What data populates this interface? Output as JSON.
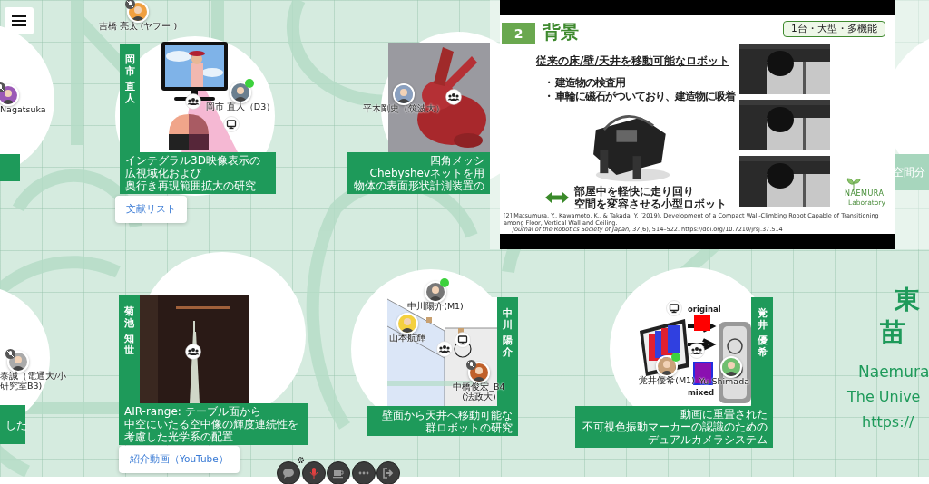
{
  "participants": [
    {
      "name": [
        "吉橋 亮太 (ヤフー )"
      ],
      "online": false,
      "muted": true
    },
    {
      "name": [
        "Nagatsuka"
      ],
      "online": false,
      "muted": true
    },
    {
      "name": [
        "岡市 直人（D3）"
      ],
      "online": true,
      "muted": false
    },
    {
      "name": [
        "平木剛史（筑波大）"
      ],
      "online": false,
      "muted": false
    },
    {
      "name": [
        "泰誠（電通大/小",
        "研究室B3)"
      ],
      "online": false,
      "muted": true
    },
    {
      "name": [
        "中川陽介(M1)"
      ],
      "online": true,
      "muted": false
    },
    {
      "name": [
        "山本航輝"
      ],
      "online": false,
      "muted": false
    },
    {
      "name": [
        "中橋俊宏_B4",
        "(法政大)"
      ],
      "online": false,
      "muted": true
    },
    {
      "name": [
        "覚井優希(M1)"
      ],
      "online": true,
      "muted": false
    },
    {
      "name": [
        "Yu Shimada"
      ],
      "online": false,
      "muted": false
    }
  ],
  "booths": [
    {
      "presenter": [
        "岡市",
        "直人"
      ],
      "title_lines": [
        "インテグラル3D映像表示の",
        "広視域化および",
        "奥行き再現範囲拡大の研究"
      ],
      "link": "文献リスト"
    },
    {
      "title_lines": [
        "四角メッシ",
        "Chebyshevネットを用",
        "物体の表面形状計測装置の"
      ]
    },
    {
      "title_lines": [
        "空間分"
      ]
    },
    {
      "title_lines": [
        "した"
      ]
    },
    {
      "presenter": [
        "菊池",
        "知世"
      ],
      "title_lines": [
        "AIR-range: テーブル面から",
        "中空にいたる空中像の輝度連続性を",
        "考慮した光学系の配置"
      ],
      "link": "紹介動画（YouTube）"
    },
    {
      "presenter": [
        "中川",
        "陽介"
      ],
      "title_lines": [
        "壁面から天井へ移動可能な",
        "群ロボットの研究"
      ]
    },
    {
      "presenter": [
        "覚井",
        "優希"
      ],
      "title_lines": [
        "動画に重畳された",
        "不可視色振動マーカーの認識のための",
        "デュアルカメラシステム"
      ]
    }
  ],
  "diagram_labels": [
    "original",
    "mixed"
  ],
  "slide": {
    "number": "2",
    "title": "背景",
    "tag": "1台・大型・多機能",
    "heading": "従来の床/壁/天井を移動可能なロボット",
    "bullet_mark": "・",
    "bullets": [
      "建造物の検査用",
      "車輪に磁石がついており、建造物に吸着"
    ],
    "caption": [
      "部屋中を軽快に走り回り",
      "空間を変容させる小型ロボット"
    ],
    "logo": "NAEMURA",
    "logo_sub": "Laboratory",
    "citation": "[2] Matsumura, Y., Kawamoto, K., & Takada, Y. (2019). Development of a Compact Wall-Climbing Robot Capable of Transitioning among Floor, Vertical Wall and Ceiling.",
    "citation_journal": "*Journal of the Robotics Society of Japan, 37*(6), 514–522. https://doi.org/10.7210/jrsj.37.514"
  },
  "lab": {
    "headline": [
      "東",
      "苗"
    ],
    "lines": [
      "Naemura",
      "The Unive",
      "https://"
    ]
  },
  "toolbar": [
    {
      "kind": "chat"
    },
    {
      "kind": "mic",
      "muted": true
    },
    {
      "kind": "coffee"
    },
    {
      "kind": "more"
    },
    {
      "kind": "exit"
    }
  ]
}
